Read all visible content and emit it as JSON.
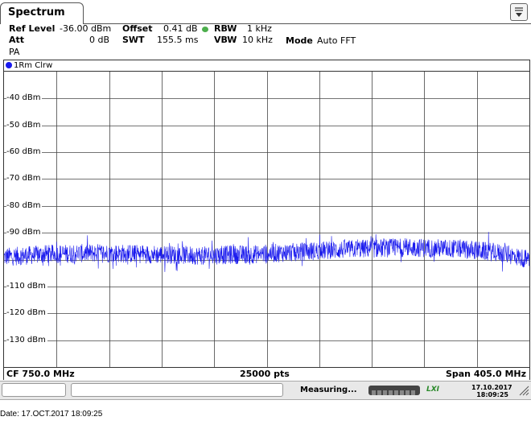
{
  "tab": {
    "title": "Spectrum"
  },
  "settings": {
    "ref_level_label": "Ref Level",
    "ref_level_value": "-36.00 dBm",
    "offset_label": "Offset",
    "offset_value": "0.41 dB",
    "rbw_label": "RBW",
    "rbw_value": "1 kHz",
    "att_label": "Att",
    "att_value": "0 dB",
    "swt_label": "SWT",
    "swt_value": "155.5 ms",
    "vbw_label": "VBW",
    "vbw_value": "10 kHz",
    "mode_label": "Mode",
    "mode_value": "Auto FFT",
    "pa_label": "PA"
  },
  "trace": {
    "label": "1Rm Clrw",
    "color": "#1a1aee"
  },
  "chart_data": {
    "type": "line",
    "title": "",
    "ylabel": "",
    "xlabel": "",
    "y_tick_labels": [
      "-40 dBm",
      "-50 dBm",
      "-60 dBm",
      "-70 dBm",
      "-80 dBm",
      "-90 dBm",
      "-110 dBm",
      "-120 dBm",
      "-130 dBm"
    ],
    "ylim": [
      -140,
      -30
    ],
    "xlim": [
      547.5,
      952.5
    ],
    "x_unit": "MHz",
    "grid": true,
    "series": [
      {
        "x": [
          547.5,
          580,
          620,
          660,
          700,
          740,
          780,
          820,
          860,
          900,
          930,
          952.5
        ],
        "y": [
          -99,
          -98,
          -97.5,
          -98,
          -98.5,
          -98,
          -97,
          -96,
          -95.5,
          -96,
          -97.5,
          -100
        ]
      }
    ]
  },
  "footer": {
    "cf": "CF 750.0 MHz",
    "pts": "25000 pts",
    "span": "Span 405.0 MHz"
  },
  "status": {
    "measuring": "Measuring...",
    "lxi": "LXI",
    "clock_date": "17.10.2017",
    "clock_time": "18:09:25"
  },
  "caption": {
    "date": "Date: 17.OCT.2017  18:09:25"
  }
}
